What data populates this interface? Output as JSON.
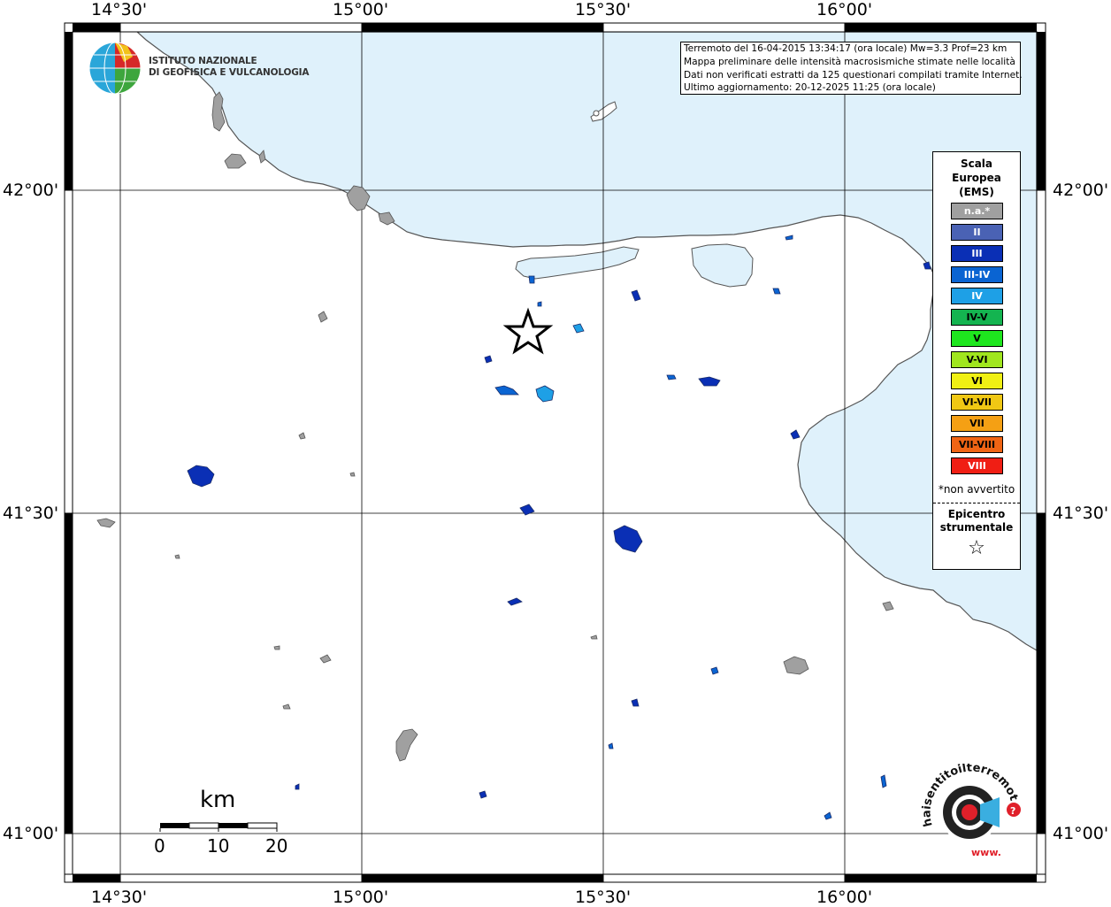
{
  "map_title_lines": [
    "Terremoto del 16-04-2015 13:34:17 (ora locale) Mw=3.3 Prof=23 km",
    "Mappa preliminare delle intensità macrosismiche stimate nelle località",
    "Dati non verificati estratti da 125 questionari compilati tramite Internet.",
    "Ultimo aggiornamento: 20-12-2025 11:25 (ora locale)"
  ],
  "institute": {
    "line1": "ISTITUTO NAZIONALE",
    "line2": "DI GEOFISICA E VULCANOLOGIA"
  },
  "grid_labels": {
    "longitudes": [
      "14°30'",
      "15°00'",
      "15°30'",
      "16°00'"
    ],
    "latitudes": [
      "42°00'",
      "41°30'",
      "41°00'"
    ]
  },
  "legend": {
    "title_lines": [
      "Scala",
      "Europea",
      "(EMS)"
    ],
    "items": [
      {
        "label": "n.a.*",
        "color": "#a0a0a0",
        "text_color": "#ffffff"
      },
      {
        "label": "II",
        "color": "#4a62b4",
        "text_color": "#ffffff"
      },
      {
        "label": "III",
        "color": "#0a2fb5",
        "text_color": "#ffffff"
      },
      {
        "label": "III-IV",
        "color": "#0a64d2",
        "text_color": "#ffffff"
      },
      {
        "label": "IV",
        "color": "#1ea0e6",
        "text_color": "#ffffff"
      },
      {
        "label": "IV-V",
        "color": "#14b450",
        "text_color": "#000000"
      },
      {
        "label": "V",
        "color": "#1ee61e",
        "text_color": "#000000"
      },
      {
        "label": "V-VI",
        "color": "#a0e61e",
        "text_color": "#000000"
      },
      {
        "label": "VI",
        "color": "#f0f014",
        "text_color": "#000000"
      },
      {
        "label": "VI-VII",
        "color": "#f0c814",
        "text_color": "#000000"
      },
      {
        "label": "VII",
        "color": "#f5a014",
        "text_color": "#000000"
      },
      {
        "label": "VII-VIII",
        "color": "#f06414",
        "text_color": "#000000"
      },
      {
        "label": "VIII",
        "color": "#f01e14",
        "text_color": "#ffffff"
      }
    ],
    "note": "*non avvertito",
    "epicenter_lines": [
      "Epicentro",
      "strumentale"
    ],
    "epicenter_symbol": "☆"
  },
  "scale_bar": {
    "unit": "km",
    "ticks": [
      "0",
      "10",
      "20"
    ]
  },
  "brand_text": "haisentitoilterremoto.it",
  "brand_url": "www."
}
